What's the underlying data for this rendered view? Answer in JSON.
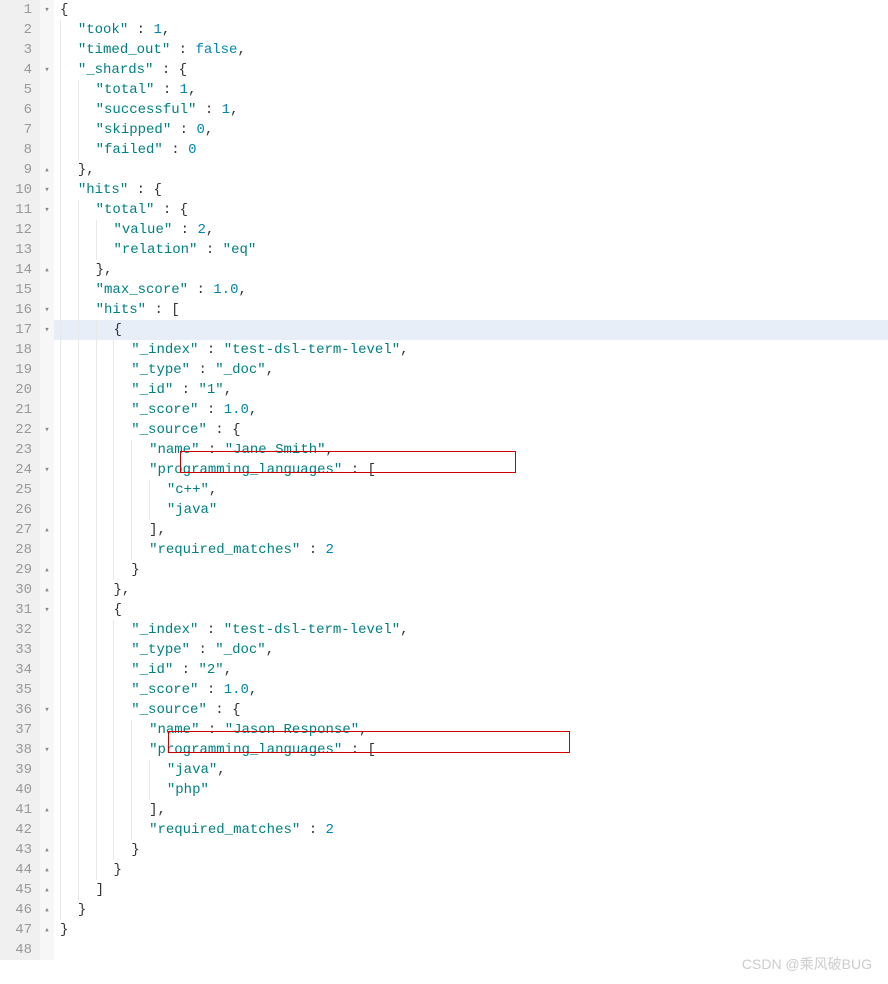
{
  "watermark": "CSDN @乘风破BUG",
  "highlighted_line": 17,
  "lines": [
    {
      "n": 1,
      "fold": "open",
      "text": "{",
      "tokens": [
        [
          "p",
          "{"
        ]
      ]
    },
    {
      "n": 2,
      "text": "  \"took\" : 1,",
      "tokens": [
        [
          "p",
          "  "
        ],
        [
          "key",
          "\"took\""
        ],
        [
          "p",
          " : "
        ],
        [
          "num",
          "1"
        ],
        [
          "p",
          ","
        ]
      ]
    },
    {
      "n": 3,
      "text": "  \"timed_out\" : false,",
      "tokens": [
        [
          "p",
          "  "
        ],
        [
          "key",
          "\"timed_out\""
        ],
        [
          "p",
          " : "
        ],
        [
          "kw",
          "false"
        ],
        [
          "p",
          ","
        ]
      ]
    },
    {
      "n": 4,
      "fold": "open",
      "text": "  \"_shards\" : {",
      "tokens": [
        [
          "p",
          "  "
        ],
        [
          "key",
          "\"_shards\""
        ],
        [
          "p",
          " : {"
        ]
      ]
    },
    {
      "n": 5,
      "text": "    \"total\" : 1,",
      "tokens": [
        [
          "p",
          "    "
        ],
        [
          "key",
          "\"total\""
        ],
        [
          "p",
          " : "
        ],
        [
          "num",
          "1"
        ],
        [
          "p",
          ","
        ]
      ]
    },
    {
      "n": 6,
      "text": "    \"successful\" : 1,",
      "tokens": [
        [
          "p",
          "    "
        ],
        [
          "key",
          "\"successful\""
        ],
        [
          "p",
          " : "
        ],
        [
          "num",
          "1"
        ],
        [
          "p",
          ","
        ]
      ]
    },
    {
      "n": 7,
      "text": "    \"skipped\" : 0,",
      "tokens": [
        [
          "p",
          "    "
        ],
        [
          "key",
          "\"skipped\""
        ],
        [
          "p",
          " : "
        ],
        [
          "num",
          "0"
        ],
        [
          "p",
          ","
        ]
      ]
    },
    {
      "n": 8,
      "text": "    \"failed\" : 0",
      "tokens": [
        [
          "p",
          "    "
        ],
        [
          "key",
          "\"failed\""
        ],
        [
          "p",
          " : "
        ],
        [
          "num",
          "0"
        ]
      ]
    },
    {
      "n": 9,
      "fold": "close",
      "text": "  },",
      "tokens": [
        [
          "p",
          "  },"
        ]
      ]
    },
    {
      "n": 10,
      "fold": "open",
      "text": "  \"hits\" : {",
      "tokens": [
        [
          "p",
          "  "
        ],
        [
          "key",
          "\"hits\""
        ],
        [
          "p",
          " : {"
        ]
      ]
    },
    {
      "n": 11,
      "fold": "open",
      "text": "    \"total\" : {",
      "tokens": [
        [
          "p",
          "    "
        ],
        [
          "key",
          "\"total\""
        ],
        [
          "p",
          " : {"
        ]
      ]
    },
    {
      "n": 12,
      "text": "      \"value\" : 2,",
      "tokens": [
        [
          "p",
          "      "
        ],
        [
          "key",
          "\"value\""
        ],
        [
          "p",
          " : "
        ],
        [
          "num",
          "2"
        ],
        [
          "p",
          ","
        ]
      ]
    },
    {
      "n": 13,
      "text": "      \"relation\" : \"eq\"",
      "tokens": [
        [
          "p",
          "      "
        ],
        [
          "key",
          "\"relation\""
        ],
        [
          "p",
          " : "
        ],
        [
          "str",
          "\"eq\""
        ]
      ]
    },
    {
      "n": 14,
      "fold": "close",
      "text": "    },",
      "tokens": [
        [
          "p",
          "    },"
        ]
      ]
    },
    {
      "n": 15,
      "text": "    \"max_score\" : 1.0,",
      "tokens": [
        [
          "p",
          "    "
        ],
        [
          "key",
          "\"max_score\""
        ],
        [
          "p",
          " : "
        ],
        [
          "num",
          "1.0"
        ],
        [
          "p",
          ","
        ]
      ]
    },
    {
      "n": 16,
      "fold": "open",
      "text": "    \"hits\" : [",
      "tokens": [
        [
          "p",
          "    "
        ],
        [
          "key",
          "\"hits\""
        ],
        [
          "p",
          " : ["
        ]
      ]
    },
    {
      "n": 17,
      "fold": "open",
      "text": "      {",
      "tokens": [
        [
          "p",
          "      {"
        ]
      ]
    },
    {
      "n": 18,
      "text": "        \"_index\" : \"test-dsl-term-level\",",
      "tokens": [
        [
          "p",
          "        "
        ],
        [
          "key",
          "\"_index\""
        ],
        [
          "p",
          " : "
        ],
        [
          "str",
          "\"test-dsl-term-level\""
        ],
        [
          "p",
          ","
        ]
      ]
    },
    {
      "n": 19,
      "text": "        \"_type\" : \"_doc\",",
      "tokens": [
        [
          "p",
          "        "
        ],
        [
          "key",
          "\"_type\""
        ],
        [
          "p",
          " : "
        ],
        [
          "str",
          "\"_doc\""
        ],
        [
          "p",
          ","
        ]
      ]
    },
    {
      "n": 20,
      "text": "        \"_id\" : \"1\",",
      "tokens": [
        [
          "p",
          "        "
        ],
        [
          "key",
          "\"_id\""
        ],
        [
          "p",
          " : "
        ],
        [
          "str",
          "\"1\""
        ],
        [
          "p",
          ","
        ]
      ]
    },
    {
      "n": 21,
      "text": "        \"_score\" : 1.0,",
      "tokens": [
        [
          "p",
          "        "
        ],
        [
          "key",
          "\"_score\""
        ],
        [
          "p",
          " : "
        ],
        [
          "num",
          "1.0"
        ],
        [
          "p",
          ","
        ]
      ]
    },
    {
      "n": 22,
      "fold": "open",
      "text": "        \"_source\" : {",
      "tokens": [
        [
          "p",
          "        "
        ],
        [
          "key",
          "\"_source\""
        ],
        [
          "p",
          " : {"
        ]
      ]
    },
    {
      "n": 23,
      "text": "          \"name\" : \"Jane Smith\",",
      "tokens": [
        [
          "p",
          "          "
        ],
        [
          "key",
          "\"name\""
        ],
        [
          "p",
          " : "
        ],
        [
          "str",
          "\"Jane Smith\""
        ],
        [
          "p",
          ","
        ]
      ]
    },
    {
      "n": 24,
      "fold": "open",
      "text": "          \"programming_languages\" : [",
      "tokens": [
        [
          "p",
          "          "
        ],
        [
          "key",
          "\"programming_languages\""
        ],
        [
          "p",
          " : ["
        ]
      ]
    },
    {
      "n": 25,
      "text": "            \"c++\",",
      "tokens": [
        [
          "p",
          "            "
        ],
        [
          "str",
          "\"c++\""
        ],
        [
          "p",
          ","
        ]
      ]
    },
    {
      "n": 26,
      "text": "            \"java\"",
      "tokens": [
        [
          "p",
          "            "
        ],
        [
          "str",
          "\"java\""
        ]
      ]
    },
    {
      "n": 27,
      "fold": "close",
      "text": "          ],",
      "tokens": [
        [
          "p",
          "          ],"
        ]
      ]
    },
    {
      "n": 28,
      "text": "          \"required_matches\" : 2",
      "tokens": [
        [
          "p",
          "          "
        ],
        [
          "key",
          "\"required_matches\""
        ],
        [
          "p",
          " : "
        ],
        [
          "num",
          "2"
        ]
      ]
    },
    {
      "n": 29,
      "fold": "close",
      "text": "        }",
      "tokens": [
        [
          "p",
          "        }"
        ]
      ]
    },
    {
      "n": 30,
      "fold": "close",
      "text": "      },",
      "tokens": [
        [
          "p",
          "      },"
        ]
      ]
    },
    {
      "n": 31,
      "fold": "open",
      "text": "      {",
      "tokens": [
        [
          "p",
          "      {"
        ]
      ]
    },
    {
      "n": 32,
      "text": "        \"_index\" : \"test-dsl-term-level\",",
      "tokens": [
        [
          "p",
          "        "
        ],
        [
          "key",
          "\"_index\""
        ],
        [
          "p",
          " : "
        ],
        [
          "str",
          "\"test-dsl-term-level\""
        ],
        [
          "p",
          ","
        ]
      ]
    },
    {
      "n": 33,
      "text": "        \"_type\" : \"_doc\",",
      "tokens": [
        [
          "p",
          "        "
        ],
        [
          "key",
          "\"_type\""
        ],
        [
          "p",
          " : "
        ],
        [
          "str",
          "\"_doc\""
        ],
        [
          "p",
          ","
        ]
      ]
    },
    {
      "n": 34,
      "text": "        \"_id\" : \"2\",",
      "tokens": [
        [
          "p",
          "        "
        ],
        [
          "key",
          "\"_id\""
        ],
        [
          "p",
          " : "
        ],
        [
          "str",
          "\"2\""
        ],
        [
          "p",
          ","
        ]
      ]
    },
    {
      "n": 35,
      "text": "        \"_score\" : 1.0,",
      "tokens": [
        [
          "p",
          "        "
        ],
        [
          "key",
          "\"_score\""
        ],
        [
          "p",
          " : "
        ],
        [
          "num",
          "1.0"
        ],
        [
          "p",
          ","
        ]
      ]
    },
    {
      "n": 36,
      "fold": "open",
      "text": "        \"_source\" : {",
      "tokens": [
        [
          "p",
          "        "
        ],
        [
          "key",
          "\"_source\""
        ],
        [
          "p",
          " : {"
        ]
      ]
    },
    {
      "n": 37,
      "text": "          \"name\" : \"Jason Response\",",
      "tokens": [
        [
          "p",
          "          "
        ],
        [
          "key",
          "\"name\""
        ],
        [
          "p",
          " : "
        ],
        [
          "str",
          "\"Jason Response\""
        ],
        [
          "p",
          ","
        ]
      ]
    },
    {
      "n": 38,
      "fold": "open",
      "text": "          \"programming_languages\" : [",
      "tokens": [
        [
          "p",
          "          "
        ],
        [
          "key",
          "\"programming_languages\""
        ],
        [
          "p",
          " : ["
        ]
      ]
    },
    {
      "n": 39,
      "text": "            \"java\",",
      "tokens": [
        [
          "p",
          "            "
        ],
        [
          "str",
          "\"java\""
        ],
        [
          "p",
          ","
        ]
      ]
    },
    {
      "n": 40,
      "text": "            \"php\"",
      "tokens": [
        [
          "p",
          "            "
        ],
        [
          "str",
          "\"php\""
        ]
      ]
    },
    {
      "n": 41,
      "fold": "close",
      "text": "          ],",
      "tokens": [
        [
          "p",
          "          ],"
        ]
      ]
    },
    {
      "n": 42,
      "text": "          \"required_matches\" : 2",
      "tokens": [
        [
          "p",
          "          "
        ],
        [
          "key",
          "\"required_matches\""
        ],
        [
          "p",
          " : "
        ],
        [
          "num",
          "2"
        ]
      ]
    },
    {
      "n": 43,
      "fold": "close",
      "text": "        }",
      "tokens": [
        [
          "p",
          "        }"
        ]
      ]
    },
    {
      "n": 44,
      "fold": "close",
      "text": "      }",
      "tokens": [
        [
          "p",
          "      }"
        ]
      ]
    },
    {
      "n": 45,
      "fold": "close",
      "text": "    ]",
      "tokens": [
        [
          "p",
          "    ]"
        ]
      ]
    },
    {
      "n": 46,
      "fold": "close",
      "text": "  }",
      "tokens": [
        [
          "p",
          "  }"
        ]
      ]
    },
    {
      "n": 47,
      "fold": "close",
      "text": "}",
      "tokens": [
        [
          "p",
          "}"
        ]
      ]
    },
    {
      "n": 48,
      "text": "",
      "tokens": []
    }
  ]
}
